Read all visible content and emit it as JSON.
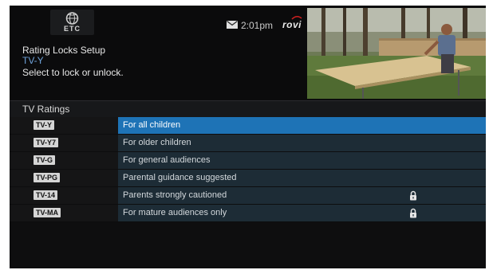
{
  "header": {
    "logo_text": "ETC",
    "clock": "2:01pm",
    "brand": "rovi",
    "title": "Rating Locks Setup",
    "subtitle": "TV-Y",
    "instruction": "Select to lock or unlock."
  },
  "section": {
    "title": "TV Ratings"
  },
  "ratings": [
    {
      "code": "TV-Y",
      "description": "For all children",
      "locked": false,
      "selected": true
    },
    {
      "code": "TV-Y7",
      "description": "For older children",
      "locked": false,
      "selected": false
    },
    {
      "code": "TV-G",
      "description": "For general audiences",
      "locked": false,
      "selected": false
    },
    {
      "code": "TV-PG",
      "description": "Parental guidance suggested",
      "locked": false,
      "selected": false
    },
    {
      "code": "TV-14",
      "description": "Parents strongly cautioned",
      "locked": true,
      "selected": false
    },
    {
      "code": "TV-MA",
      "description": "For mature audiences only",
      "locked": true,
      "selected": false
    }
  ],
  "icons": {
    "message": "envelope-icon",
    "lock": "padlock-icon"
  },
  "colors": {
    "selected_row": "#1e73b6",
    "subtitle": "#6fa2d9",
    "row": "#1d2c36"
  }
}
